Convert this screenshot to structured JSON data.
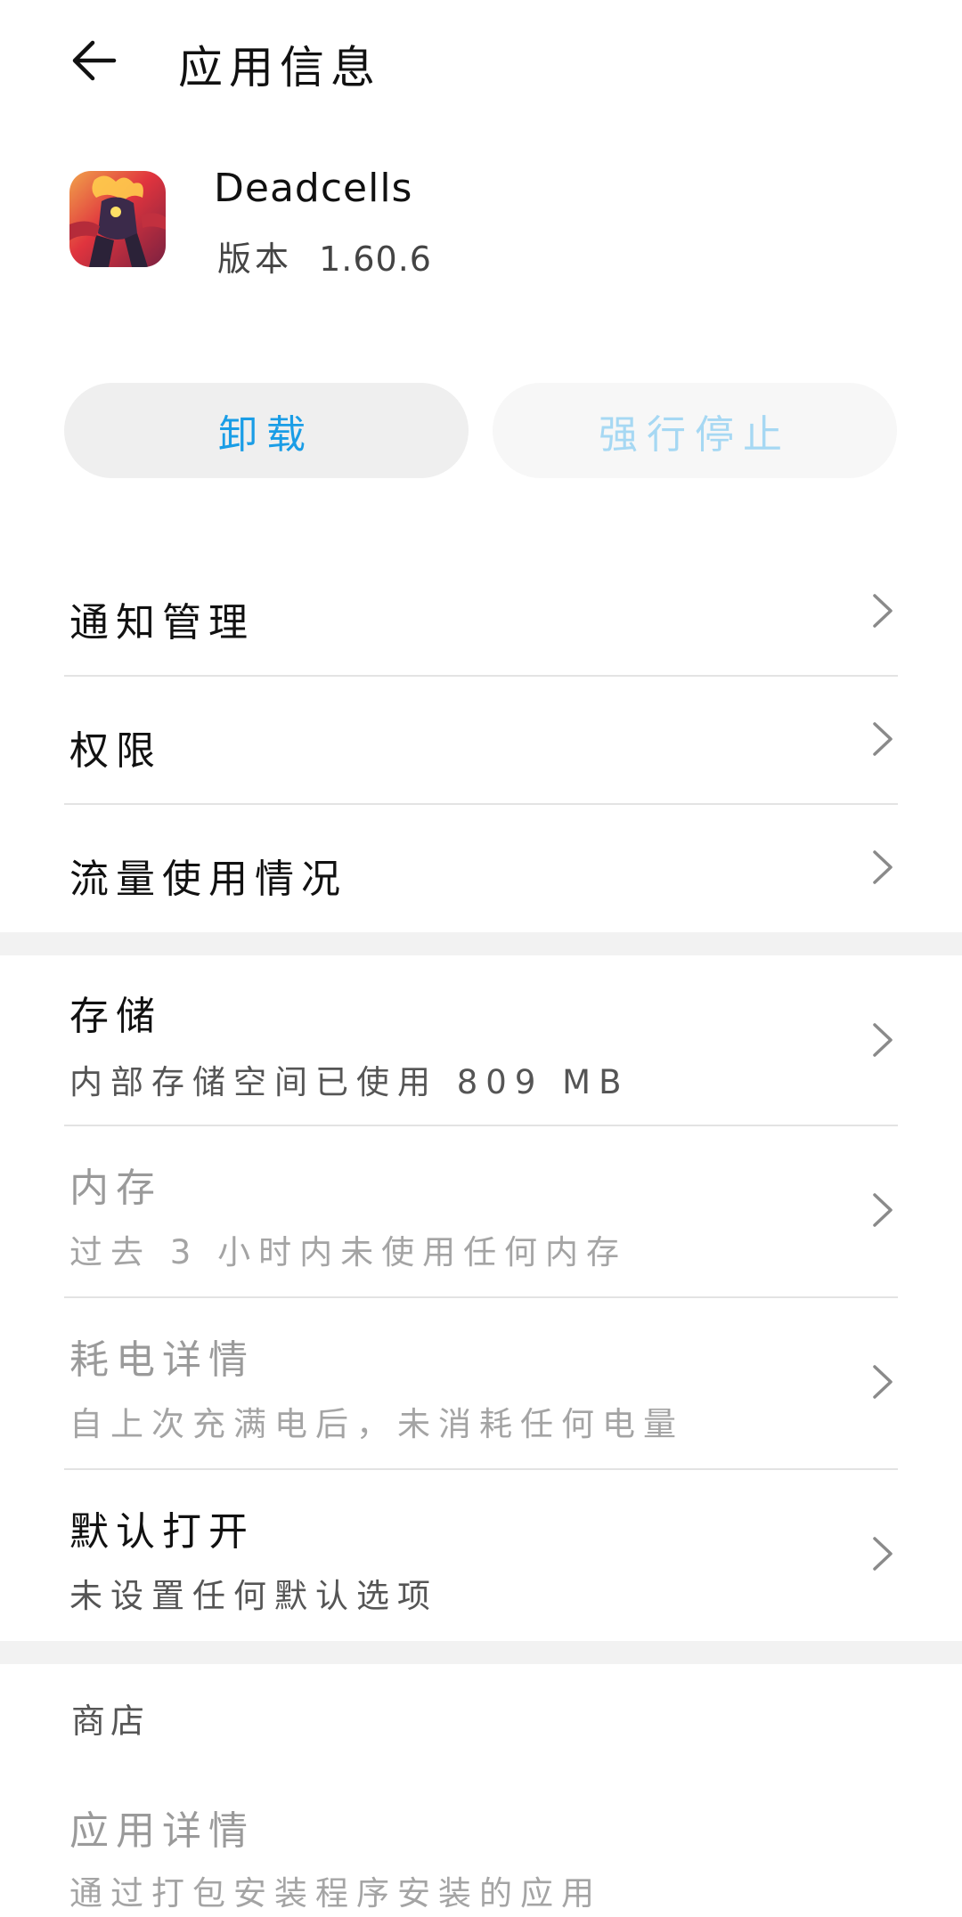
{
  "header": {
    "title": "应用信息"
  },
  "app": {
    "name": "Deadcells",
    "version_label": "版本",
    "version": "1.60.6"
  },
  "buttons": {
    "uninstall": "卸载",
    "force_stop": "强行停止"
  },
  "list1": [
    {
      "label": "通知管理"
    },
    {
      "label": "权限"
    },
    {
      "label": "流量使用情况"
    }
  ],
  "list2": [
    {
      "label": "存储",
      "sub": "内部存储空间已使用 809 MB"
    },
    {
      "label": "内存",
      "sub": "过去 3 小时内未使用任何内存"
    },
    {
      "label": "耗电详情",
      "sub": "自上次充满电后，未消耗任何电量"
    },
    {
      "label": "默认打开",
      "sub": "未设置任何默认选项"
    }
  ],
  "store": {
    "section_label": "商店",
    "details_label": "应用详情",
    "details_sub": "通过打包安装程序安装的应用"
  },
  "colors": {
    "accent": "#1a9de6",
    "accent_disabled": "#a6d8f3"
  }
}
